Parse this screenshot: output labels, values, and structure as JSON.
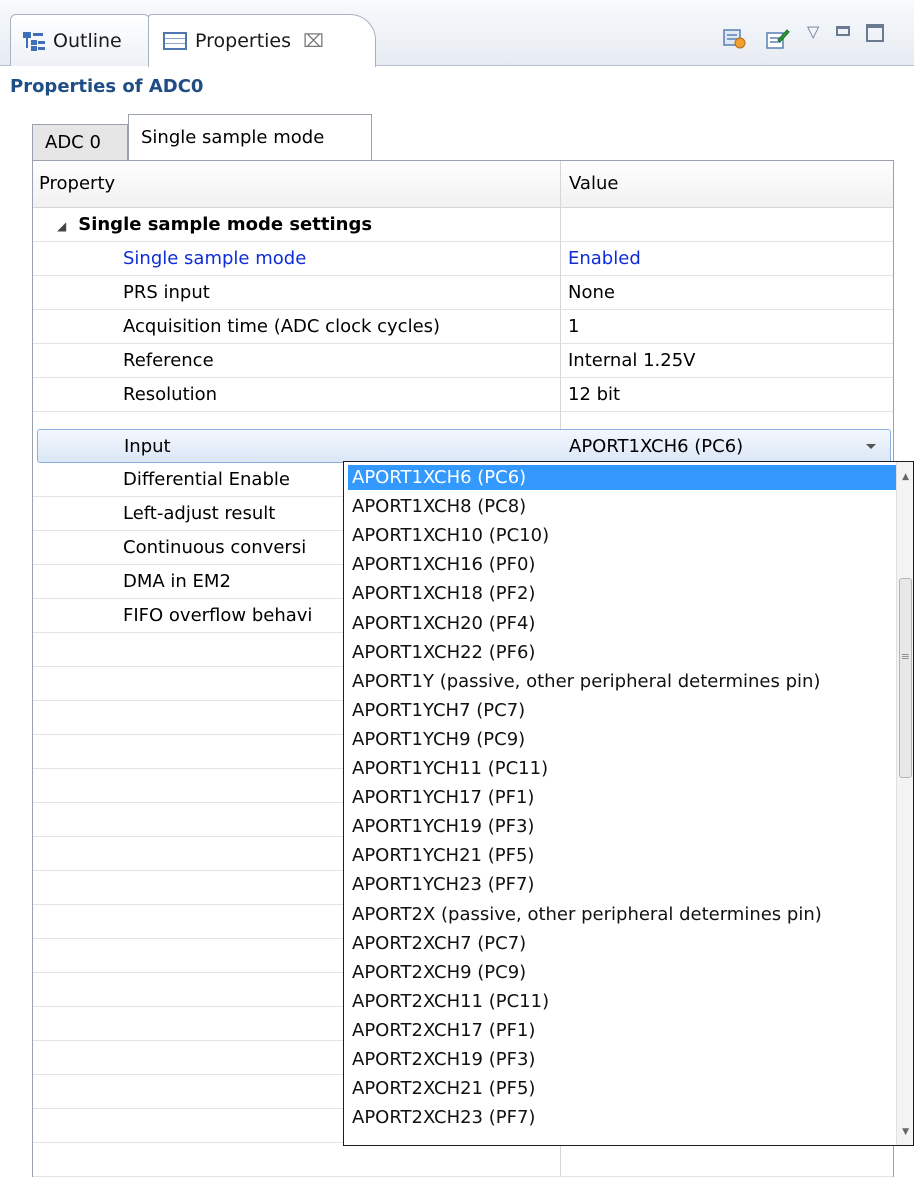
{
  "view_tabs": [
    {
      "label": "Outline",
      "icon": "outline-icon"
    },
    {
      "label": "Properties",
      "icon": "properties-icon",
      "close_glyph": "⌧"
    }
  ],
  "toolbar": {
    "menu_glyph": "▽",
    "icons": [
      "properties-link-icon",
      "pin-icon",
      "view-menu-icon",
      "minimize-icon",
      "maximize-icon"
    ]
  },
  "properties_title": "Properties of ADC0",
  "page_tabs": [
    "ADC 0",
    "Single sample mode"
  ],
  "table": {
    "headers": {
      "property": "Property",
      "value": "Value"
    },
    "category": {
      "label": "Single sample mode settings",
      "expand_glyph": "◢"
    },
    "rows": [
      {
        "label": "Single sample mode",
        "value": "Enabled"
      },
      {
        "label": "PRS input",
        "value": "None"
      },
      {
        "label": "Acquisition time (ADC clock cycles)",
        "value": "1"
      },
      {
        "label": "Reference",
        "value": "Internal 1.25V"
      },
      {
        "label": "Resolution",
        "value": "12 bit"
      },
      {
        "label": "Input",
        "value": "APORT1XCH6 (PC6)"
      },
      {
        "label": "Differential Enable",
        "value": ""
      },
      {
        "label": "Left-adjust result",
        "value": ""
      },
      {
        "label": "Continuous conversi",
        "value": ""
      },
      {
        "label": "DMA in EM2",
        "value": ""
      },
      {
        "label": "FIFO overflow behavi",
        "value": ""
      }
    ]
  },
  "dropdown": {
    "selected_index": 0,
    "options": [
      "APORT1XCH6 (PC6)",
      "APORT1XCH8 (PC8)",
      "APORT1XCH10 (PC10)",
      "APORT1XCH16 (PF0)",
      "APORT1XCH18 (PF2)",
      "APORT1XCH20 (PF4)",
      "APORT1XCH22 (PF6)",
      "APORT1Y (passive, other peripheral determines pin)",
      "APORT1YCH7 (PC7)",
      "APORT1YCH9 (PC9)",
      "APORT1YCH11 (PC11)",
      "APORT1YCH17 (PF1)",
      "APORT1YCH19 (PF3)",
      "APORT1YCH21 (PF5)",
      "APORT1YCH23 (PF7)",
      "APORT2X (passive, other peripheral determines pin)",
      "APORT2XCH7 (PC7)",
      "APORT2XCH9 (PC9)",
      "APORT2XCH11 (PC11)",
      "APORT2XCH17 (PF1)",
      "APORT2XCH19 (PF3)",
      "APORT2XCH21 (PF5)",
      "APORT2XCH23 (PF7)"
    ],
    "scroll_grip_glyph": "≡"
  },
  "colors": {
    "modified_property": "#0e2cd8",
    "selection": "#3399ff",
    "title": "#1f4e86"
  }
}
